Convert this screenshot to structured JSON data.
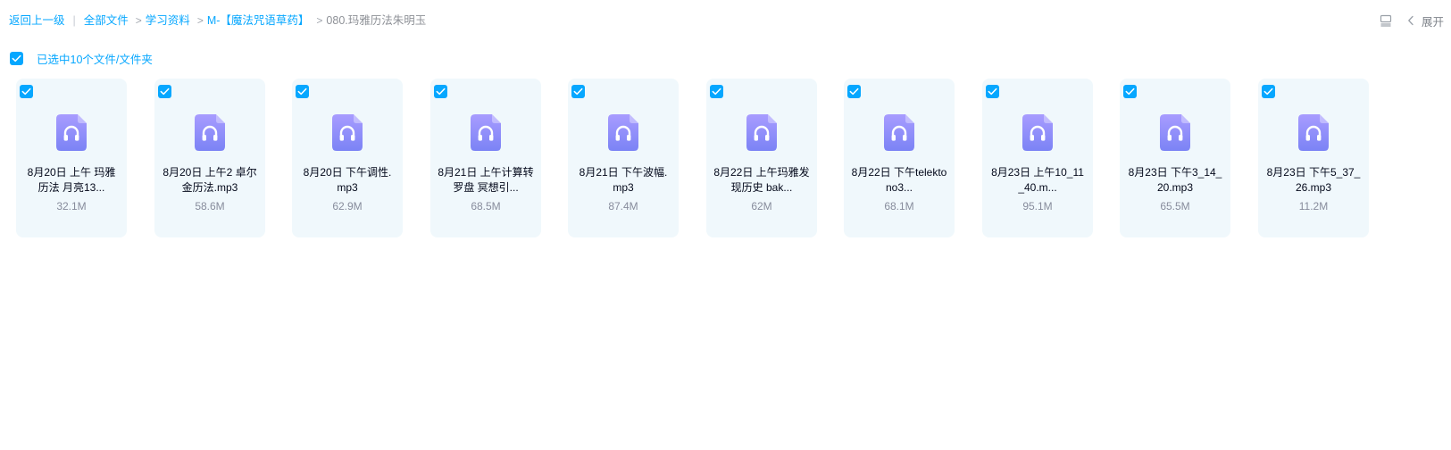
{
  "breadcrumb": {
    "back": "返回上一级",
    "divider": "|",
    "sep": ">",
    "items": [
      "全部文件",
      "学习资料",
      "M-【魔法咒语草药】"
    ],
    "current": "080.玛雅历法朱明玉"
  },
  "top_actions": {
    "expand_label": "展开",
    "icons": [
      "list-view-icon",
      "chevron-left-icon"
    ]
  },
  "selection": {
    "text": "已选中10个文件/文件夹",
    "checked": true
  },
  "colors": {
    "accent": "#06a7ff",
    "card_bg": "#f0f8fc",
    "icon_gradient_top": "#a89cff",
    "icon_gradient_bottom": "#7b83f5"
  },
  "files": [
    {
      "name": "8月20日 上午 玛雅历法 月亮13...",
      "size": "32.1M",
      "icon": "audio-file-icon",
      "checked": true
    },
    {
      "name": "8月20日 上午2 卓尔金历法.mp3",
      "size": "58.6M",
      "icon": "audio-file-icon",
      "checked": true
    },
    {
      "name": "8月20日 下午调性.mp3",
      "size": "62.9M",
      "icon": "audio-file-icon",
      "checked": true
    },
    {
      "name": "8月21日 上午计算转罗盘 冥想引...",
      "size": "68.5M",
      "icon": "audio-file-icon",
      "checked": true
    },
    {
      "name": "8月21日 下午波幅.mp3",
      "size": "87.4M",
      "icon": "audio-file-icon",
      "checked": true
    },
    {
      "name": "8月22日 上午玛雅发现历史 bak...",
      "size": "62M",
      "icon": "audio-file-icon",
      "checked": true
    },
    {
      "name": "8月22日 下午telektono3...",
      "size": "68.1M",
      "icon": "audio-file-icon",
      "checked": true
    },
    {
      "name": "8月23日 上午10_11_40.m...",
      "size": "95.1M",
      "icon": "audio-file-icon",
      "checked": true
    },
    {
      "name": "8月23日 下午3_14_20.mp3",
      "size": "65.5M",
      "icon": "audio-file-icon",
      "checked": true
    },
    {
      "name": "8月23日 下午5_37_26.mp3",
      "size": "11.2M",
      "icon": "audio-file-icon",
      "checked": true
    }
  ]
}
